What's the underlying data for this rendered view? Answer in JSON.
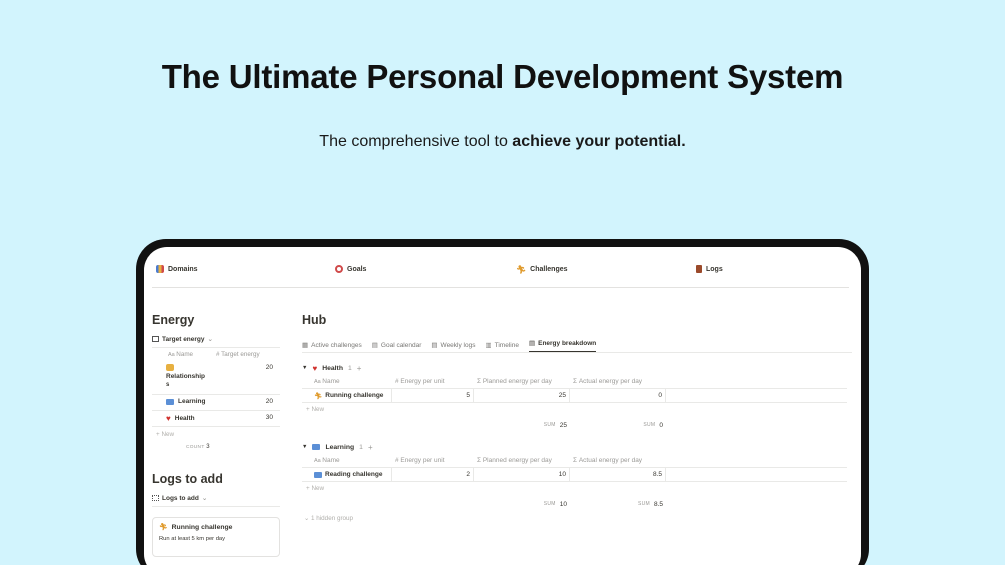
{
  "hero": {
    "title": "The Ultimate Personal Development System",
    "subtitle_prefix": "The comprehensive tool to ",
    "subtitle_bold": "achieve your potential."
  },
  "nav": {
    "items": [
      {
        "label": "Domains",
        "icon": "chart-icon"
      },
      {
        "label": "Goals",
        "icon": "target-icon"
      },
      {
        "label": "Challenges",
        "icon": "runner-icon"
      },
      {
        "label": "Logs",
        "icon": "scroll-icon"
      }
    ]
  },
  "energy": {
    "title": "Energy",
    "view_label": "Target energy",
    "columns": {
      "name": "Name",
      "target": "Target energy"
    },
    "rows": [
      {
        "name": "Relationship",
        "name_extra": "s",
        "value": "20",
        "icon": "people-icon"
      },
      {
        "name": "Learning",
        "value": "20",
        "icon": "book-icon"
      },
      {
        "name": "Health",
        "value": "30",
        "icon": "heart-icon"
      }
    ],
    "new_label": "New",
    "count_label": "COUNT",
    "count_value": "3"
  },
  "logs": {
    "title": "Logs to add",
    "view_label": "Logs to add",
    "card_title": "Running challenge",
    "card_desc": "Run at least 5 km per day"
  },
  "hub": {
    "title": "Hub",
    "tabs": [
      "Active challenges",
      "Goal calendar",
      "Weekly logs",
      "Timeline",
      "Energy breakdown"
    ],
    "columns": {
      "name": "Name",
      "unit": "Energy per unit",
      "planned": "Planned energy per day",
      "actual": "Actual energy per day"
    },
    "groups": [
      {
        "name": "Health",
        "count": "1",
        "icon": "heart-icon",
        "rows": [
          {
            "name": "Running challenge",
            "unit": "5",
            "planned": "25",
            "actual": "0",
            "icon": "runner-icon"
          }
        ],
        "sum_planned": "25",
        "sum_actual": "0"
      },
      {
        "name": "Learning",
        "count": "1",
        "icon": "book-icon",
        "rows": [
          {
            "name": "Reading challenge",
            "unit": "2",
            "planned": "10",
            "actual": "8.5",
            "icon": "book-icon"
          }
        ],
        "sum_planned": "10",
        "sum_actual": "8.5"
      }
    ],
    "new_label": "New",
    "sum_label": "SUM",
    "hidden_group": "1 hidden group"
  }
}
